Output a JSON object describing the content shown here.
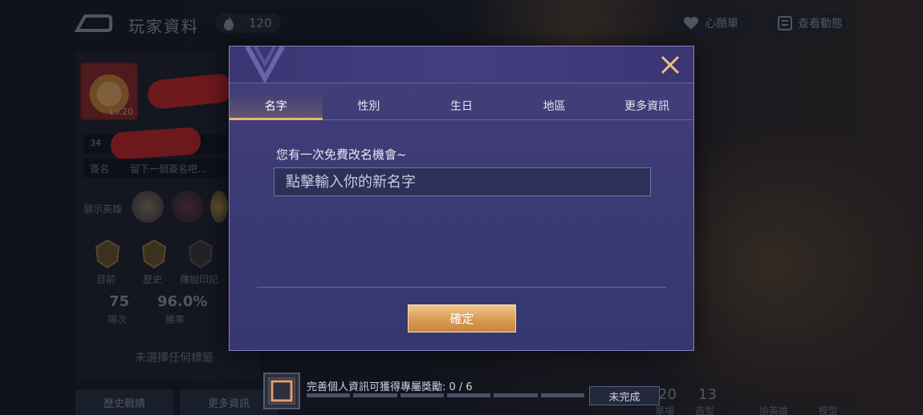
{
  "top_bar": {
    "title": "玩家資料",
    "points_value": "120",
    "wishlist_label": "心願單",
    "dynamics_label": "查看動態"
  },
  "profile": {
    "level": "Lv.20",
    "id_prefix": "34",
    "signature_label": "簽名",
    "signature_placeholder": "留下一個簽名吧...",
    "heroes_label": "展示英雄",
    "ranks": [
      "目前",
      "歷史",
      "傳說印記"
    ],
    "stats": [
      {
        "value": "75",
        "label": "場次"
      },
      {
        "value": "96.0%",
        "label": "勝率"
      }
    ],
    "no_tag": "未選擇任何標籤",
    "bottom_buttons": [
      "歷史戰績",
      "更多資訊"
    ]
  },
  "right_stats": {
    "values": [
      "20",
      "13"
    ],
    "labels": [
      "單場",
      "造型",
      "換英雄",
      "模型"
    ]
  },
  "quest": {
    "text": "完善個人資訊可獲得專屬獎勵: 0 / 6",
    "progress": 0,
    "total": 6,
    "status_button": "未完成"
  },
  "modal": {
    "tabs": [
      "名字",
      "性別",
      "生日",
      "地區",
      "更多資訊"
    ],
    "active_tab": "名字",
    "hint": "您有一次免費改名機會~",
    "input": {
      "placeholder": "點擊輸入你的新名字",
      "value": ""
    },
    "confirm_label": "確定",
    "accent_color": "#e7b56e"
  }
}
